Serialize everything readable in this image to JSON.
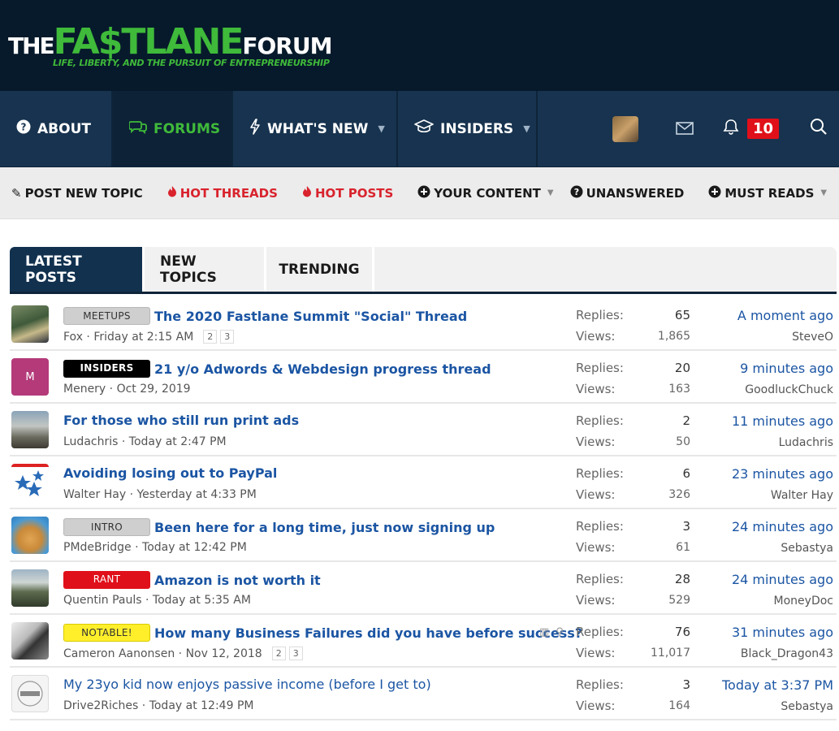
{
  "logo": {
    "the": "THE",
    "fast": "FA$TLANE",
    "forum": "FORUM",
    "tagline": "LIFE, LIBERTY, AND THE PURSUIT OF ENTREPRENEURSHIP"
  },
  "nav": {
    "about": "ABOUT",
    "forums": "FORUMS",
    "whats_new": "WHAT'S NEW",
    "insiders": "INSIDERS",
    "alerts_count": "10"
  },
  "subnav": {
    "post_new_topic": "POST NEW TOPIC",
    "hot_threads": "HOT THREADS",
    "hot_posts": "HOT POSTS",
    "your_content": "YOUR CONTENT",
    "unanswered": "UNANSWERED",
    "must_reads": "MUST READS"
  },
  "tabs": {
    "latest": "LATEST POSTS",
    "new_topics": "NEW TOPICS",
    "trending": "TRENDING"
  },
  "labels": {
    "replies": "Replies:",
    "views": "Views:"
  },
  "threads": [
    {
      "prefix": "MEETUPS",
      "title": "The 2020 Fastlane Summit \"Social\" Thread",
      "author": "Fox",
      "date": "Friday at 2:15 AM",
      "replies": "65",
      "views": "1,865",
      "last_time": "A moment ago",
      "last_user": "SteveO"
    },
    {
      "prefix": "INSIDERS",
      "title": "21 y/o Adwords & Webdesign progress thread",
      "author": "Menery",
      "date": "Oct 29, 2019",
      "replies": "20",
      "views": "163",
      "last_time": "9 minutes ago",
      "last_user": "GoodluckChuck",
      "avatar_letter": "M"
    },
    {
      "prefix": "",
      "title": "For those who still run print ads",
      "author": "Ludachris",
      "date": "Today at 2:47 PM",
      "replies": "2",
      "views": "50",
      "last_time": "11 minutes ago",
      "last_user": "Ludachris"
    },
    {
      "prefix": "",
      "title": "Avoiding losing out to PayPal",
      "author": "Walter Hay",
      "date": "Yesterday at 4:33 PM",
      "replies": "6",
      "views": "326",
      "last_time": "23 minutes ago",
      "last_user": "Walter Hay"
    },
    {
      "prefix": "INTRO",
      "title": "Been here for a long time, just now signing up",
      "author": "PMdeBridge",
      "date": "Today at 12:42 PM",
      "replies": "3",
      "views": "61",
      "last_time": "24 minutes ago",
      "last_user": "Sebastya"
    },
    {
      "prefix": "RANT",
      "title": "Amazon is not worth it",
      "author": "Quentin Pauls",
      "date": "Today at 5:35 AM",
      "replies": "28",
      "views": "529",
      "last_time": "24 minutes ago",
      "last_user": "MoneyDoc"
    },
    {
      "prefix": "NOTABLE!",
      "title": "How many Business Failures did you have before success?",
      "author": "Cameron Aanonsen",
      "date": "Nov 12, 2018",
      "replies": "76",
      "views": "11,017",
      "last_time": "31 minutes ago",
      "last_user": "Black_Dragon43"
    },
    {
      "prefix": "",
      "title": "My 23yo kid now enjoys passive income (before I get to)",
      "author": "Drive2Riches",
      "date": "Today at 12:49 PM",
      "replies": "3",
      "views": "164",
      "last_time": "Today at 3:37 PM",
      "last_user": "Sebastya"
    }
  ],
  "page_numbers": {
    "p2": "2",
    "p3": "3"
  },
  "colors": {
    "header_bg": "#071a2b",
    "nav_bg": "#17334f",
    "accent_green": "#3fba3a",
    "link_blue": "#1b55a3",
    "hot_red": "#d9232d"
  }
}
